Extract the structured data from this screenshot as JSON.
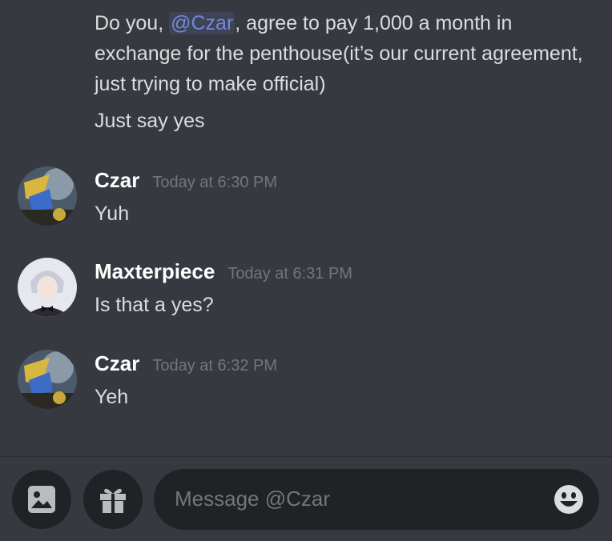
{
  "dm": {
    "continuation": {
      "line_prefix": "Do you, ",
      "mention": "@Czar",
      "line_suffix": ", agree to pay 1,000 a month in exchange for the penthouse(it’s our current agreement, just trying to make official)",
      "second_message": "Just say yes"
    },
    "messages": [
      {
        "username": "Czar",
        "timestamp": "Today at 6:30 PM",
        "text": "Yuh"
      },
      {
        "username": "Maxterpiece",
        "timestamp": "Today at 6:31 PM",
        "text": "Is that a yes?"
      },
      {
        "username": "Czar",
        "timestamp": "Today at 6:32 PM",
        "text": "Yeh"
      }
    ]
  },
  "composer": {
    "placeholder": "Message @Czar",
    "icons": [
      "image-icon",
      "gift-icon",
      "emoji-icon"
    ]
  },
  "colors": {
    "background": "#36393f",
    "mention": "#7289da",
    "timestamp": "#72767d",
    "input": "#202225"
  }
}
